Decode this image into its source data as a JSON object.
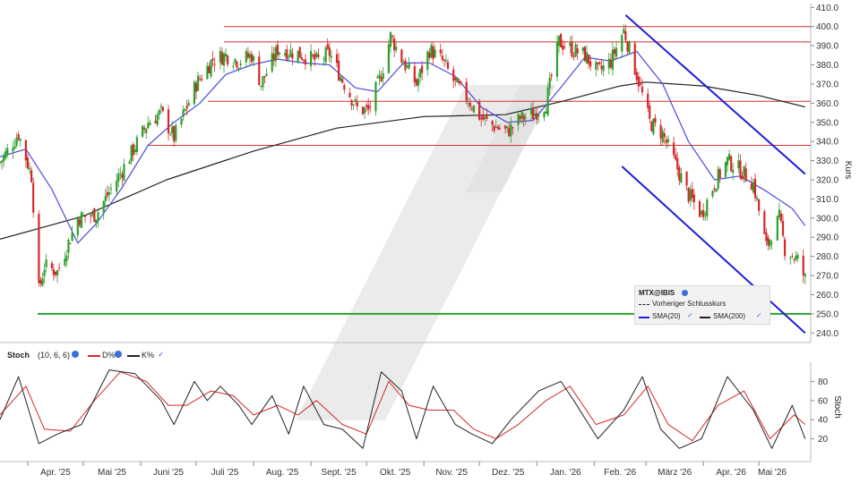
{
  "symbol": "MTX@IBIS",
  "legend": {
    "symbol_label": "MTX@IBIS",
    "prev_close": "Vorheriger Schlusskurs",
    "sma20": "SMA(20)",
    "sma200": "SMA(200)"
  },
  "stoch_header": {
    "name": "Stoch",
    "params": "(10, 6, 6)",
    "d_label": "D%",
    "k_label": "K%"
  },
  "axis": {
    "price_label": "Kurs",
    "stoch_label": "Stoch"
  },
  "colors": {
    "candle_up": "#2ca02c",
    "candle_down": "#d62728",
    "sma20": "#4a4ae0",
    "sma200": "#222222",
    "horizontal_lines": "#d32f2f",
    "support_line": "#2e9e2e",
    "channel": "#1f1fd9",
    "stoch_k": "#222222",
    "stoch_d": "#d62728"
  },
  "chart_data": {
    "type": "candlestick",
    "x_tick_labels": [
      "Apr. '25",
      "Mai '25",
      "Juni '25",
      "Juli '25",
      "Aug. '25",
      "Sept. '25",
      "Okt. '25",
      "Nov. '25",
      "Dez. '25",
      "Jan. '26",
      "Feb. '26",
      "März '26",
      "Apr. '26",
      "Mai '26"
    ],
    "y_tick_labels": [
      "240.0",
      "250.0",
      "260.0",
      "270.0",
      "280.0",
      "290.0",
      "300.0",
      "310.0",
      "320.0",
      "330.0",
      "340.0",
      "350.0",
      "360.0",
      "370.0",
      "380.0",
      "390.0",
      "400.0",
      "410.0"
    ],
    "ylim": [
      235,
      412
    ],
    "stoch_ticks": [
      "20",
      "40",
      "60",
      "80"
    ],
    "stoch_ylim": [
      0,
      100
    ],
    "horizontal_levels": [
      400,
      392,
      361,
      338
    ],
    "support_level": 250,
    "channel": {
      "upper": [
        [
          "2026-02-18",
          406
        ],
        [
          "2026-05-26",
          323
        ]
      ],
      "lower": [
        [
          "2026-02-16",
          327
        ],
        [
          "2026-05-26",
          240
        ]
      ]
    },
    "close_path": [
      [
        "2025-03-17",
        329
      ],
      [
        "2025-03-27",
        344
      ],
      [
        "2025-04-03",
        322
      ],
      [
        "2025-04-07",
        262
      ],
      [
        "2025-04-10",
        275
      ],
      [
        "2025-04-17",
        272
      ],
      [
        "2025-04-28",
        300
      ],
      [
        "2025-05-08",
        302
      ],
      [
        "2025-05-22",
        325
      ],
      [
        "2025-06-05",
        350
      ],
      [
        "2025-06-12",
        355
      ],
      [
        "2025-06-19",
        342
      ],
      [
        "2025-07-01",
        370
      ],
      [
        "2025-07-10",
        383
      ],
      [
        "2025-07-17",
        385
      ],
      [
        "2025-07-24",
        382
      ],
      [
        "2025-07-31",
        385
      ],
      [
        "2025-08-05",
        370
      ],
      [
        "2025-08-14",
        388
      ],
      [
        "2025-08-25",
        386
      ],
      [
        "2025-09-04",
        382
      ],
      [
        "2025-09-11",
        386
      ],
      [
        "2025-09-18",
        372
      ],
      [
        "2025-09-26",
        357
      ],
      [
        "2025-10-02",
        356
      ],
      [
        "2025-10-09",
        375
      ],
      [
        "2025-10-14",
        395
      ],
      [
        "2025-10-20",
        383
      ],
      [
        "2025-10-28",
        370
      ],
      [
        "2025-11-04",
        388
      ],
      [
        "2025-11-11",
        382
      ],
      [
        "2025-11-18",
        370
      ],
      [
        "2025-11-25",
        362
      ],
      [
        "2025-12-02",
        352
      ],
      [
        "2025-12-09",
        348
      ],
      [
        "2025-12-16",
        345
      ],
      [
        "2025-12-23",
        352
      ],
      [
        "2025-12-30",
        354
      ],
      [
        "2026-01-06",
        360
      ],
      [
        "2026-01-13",
        392
      ],
      [
        "2026-01-20",
        388
      ],
      [
        "2026-01-27",
        385
      ],
      [
        "2026-02-03",
        376
      ],
      [
        "2026-02-10",
        382
      ],
      [
        "2026-02-17",
        398
      ],
      [
        "2026-02-24",
        375
      ],
      [
        "2026-03-03",
        350
      ],
      [
        "2026-03-10",
        344
      ],
      [
        "2026-03-17",
        328
      ],
      [
        "2026-03-24",
        312
      ],
      [
        "2026-03-31",
        302
      ],
      [
        "2026-04-07",
        318
      ],
      [
        "2026-04-14",
        330
      ],
      [
        "2026-04-21",
        325
      ],
      [
        "2026-04-28",
        318
      ],
      [
        "2026-05-05",
        285
      ],
      [
        "2026-05-12",
        300
      ],
      [
        "2026-05-15",
        284
      ],
      [
        "2026-05-22",
        278
      ],
      [
        "2026-05-26",
        268
      ]
    ],
    "sma20": [
      [
        "2025-03-17",
        332
      ],
      [
        "2025-03-31",
        336
      ],
      [
        "2025-04-14",
        315
      ],
      [
        "2025-04-28",
        287
      ],
      [
        "2025-05-08",
        297
      ],
      [
        "2025-05-22",
        316
      ],
      [
        "2025-06-05",
        338
      ],
      [
        "2025-06-19",
        350
      ],
      [
        "2025-07-03",
        360
      ],
      [
        "2025-07-17",
        375
      ],
      [
        "2025-07-31",
        380
      ],
      [
        "2025-08-14",
        383
      ],
      [
        "2025-08-28",
        381
      ],
      [
        "2025-09-11",
        380
      ],
      [
        "2025-09-25",
        368
      ],
      [
        "2025-10-07",
        366
      ],
      [
        "2025-10-21",
        381
      ],
      [
        "2025-11-04",
        381
      ],
      [
        "2025-11-18",
        374
      ],
      [
        "2025-12-02",
        358
      ],
      [
        "2025-12-16",
        350
      ],
      [
        "2025-12-30",
        351
      ],
      [
        "2026-01-13",
        367
      ],
      [
        "2026-01-27",
        384
      ],
      [
        "2026-02-10",
        382
      ],
      [
        "2026-02-24",
        387
      ],
      [
        "2026-03-10",
        370
      ],
      [
        "2026-03-24",
        340
      ],
      [
        "2026-04-07",
        320
      ],
      [
        "2026-04-21",
        322
      ],
      [
        "2026-05-05",
        314
      ],
      [
        "2026-05-19",
        305
      ],
      [
        "2026-05-26",
        296
      ]
    ],
    "sma200": [
      [
        "2025-03-17",
        289
      ],
      [
        "2025-05-01",
        301
      ],
      [
        "2025-06-15",
        320
      ],
      [
        "2025-08-01",
        335
      ],
      [
        "2025-09-15",
        347
      ],
      [
        "2025-11-01",
        353
      ],
      [
        "2025-12-15",
        354
      ],
      [
        "2026-01-15",
        361
      ],
      [
        "2026-02-15",
        369
      ],
      [
        "2026-03-01",
        371
      ],
      [
        "2026-04-01",
        369
      ],
      [
        "2026-05-01",
        364
      ],
      [
        "2026-05-26",
        358
      ]
    ],
    "stoch_k": [
      [
        "2025-03-17",
        40
      ],
      [
        "2025-03-27",
        85
      ],
      [
        "2025-04-07",
        15
      ],
      [
        "2025-04-17",
        25
      ],
      [
        "2025-04-30",
        35
      ],
      [
        "2025-05-15",
        92
      ],
      [
        "2025-05-29",
        88
      ],
      [
        "2025-06-12",
        60
      ],
      [
        "2025-06-19",
        35
      ],
      [
        "2025-06-30",
        80
      ],
      [
        "2025-07-07",
        60
      ],
      [
        "2025-07-14",
        75
      ],
      [
        "2025-07-24",
        55
      ],
      [
        "2025-07-31",
        35
      ],
      [
        "2025-08-11",
        65
      ],
      [
        "2025-08-20",
        25
      ],
      [
        "2025-08-28",
        75
      ],
      [
        "2025-09-08",
        35
      ],
      [
        "2025-09-18",
        30
      ],
      [
        "2025-09-29",
        10
      ],
      [
        "2025-10-09",
        90
      ],
      [
        "2025-10-20",
        70
      ],
      [
        "2025-10-28",
        20
      ],
      [
        "2025-11-06",
        75
      ],
      [
        "2025-11-18",
        35
      ],
      [
        "2025-11-27",
        25
      ],
      [
        "2025-12-08",
        15
      ],
      [
        "2025-12-18",
        40
      ],
      [
        "2026-01-02",
        70
      ],
      [
        "2026-01-14",
        80
      ],
      [
        "2026-01-21",
        60
      ],
      [
        "2026-02-03",
        20
      ],
      [
        "2026-02-17",
        50
      ],
      [
        "2026-02-27",
        85
      ],
      [
        "2026-03-09",
        30
      ],
      [
        "2026-03-19",
        10
      ],
      [
        "2026-03-31",
        20
      ],
      [
        "2026-04-14",
        85
      ],
      [
        "2026-04-28",
        50
      ],
      [
        "2026-05-08",
        10
      ],
      [
        "2026-05-19",
        55
      ],
      [
        "2026-05-26",
        20
      ]
    ],
    "stoch_d": [
      [
        "2025-03-17",
        45
      ],
      [
        "2025-03-31",
        75
      ],
      [
        "2025-04-10",
        30
      ],
      [
        "2025-04-24",
        28
      ],
      [
        "2025-05-07",
        60
      ],
      [
        "2025-05-21",
        90
      ],
      [
        "2025-06-04",
        80
      ],
      [
        "2025-06-16",
        55
      ],
      [
        "2025-06-26",
        55
      ],
      [
        "2025-07-09",
        70
      ],
      [
        "2025-07-21",
        65
      ],
      [
        "2025-08-01",
        45
      ],
      [
        "2025-08-14",
        55
      ],
      [
        "2025-08-25",
        45
      ],
      [
        "2025-09-04",
        60
      ],
      [
        "2025-09-18",
        35
      ],
      [
        "2025-10-01",
        25
      ],
      [
        "2025-10-13",
        80
      ],
      [
        "2025-10-24",
        55
      ],
      [
        "2025-11-04",
        50
      ],
      [
        "2025-11-17",
        50
      ],
      [
        "2025-11-28",
        30
      ],
      [
        "2025-12-10",
        20
      ],
      [
        "2025-12-22",
        35
      ],
      [
        "2026-01-06",
        60
      ],
      [
        "2026-01-19",
        75
      ],
      [
        "2026-02-02",
        35
      ],
      [
        "2026-02-17",
        45
      ],
      [
        "2026-03-02",
        75
      ],
      [
        "2026-03-13",
        35
      ],
      [
        "2026-03-26",
        18
      ],
      [
        "2026-04-09",
        55
      ],
      [
        "2026-04-23",
        70
      ],
      [
        "2026-05-07",
        20
      ],
      [
        "2026-05-20",
        45
      ],
      [
        "2026-05-26",
        35
      ]
    ]
  }
}
